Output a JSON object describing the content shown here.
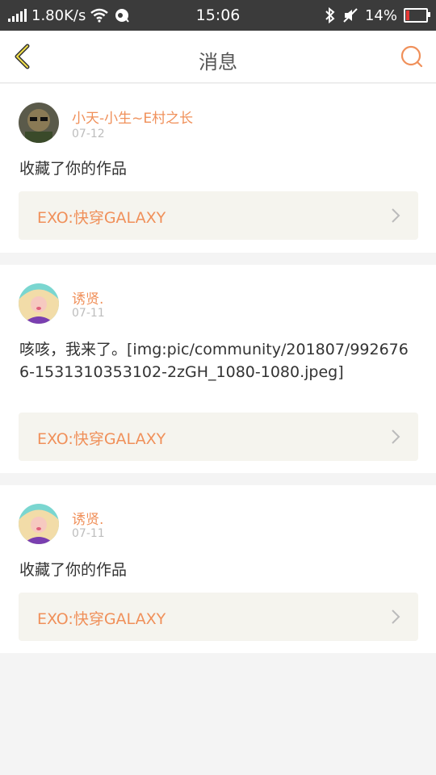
{
  "status_bar": {
    "speed": "1.80K/s",
    "time": "15:06",
    "battery": "14%"
  },
  "header": {
    "title": "消息"
  },
  "messages": [
    {
      "user": "小天-小生~E村之长",
      "date": "07-12",
      "content": "收藏了你的作品",
      "work_title": "EXO:快穿GALAXY"
    },
    {
      "user": "诱贤.",
      "date": "07-11",
      "content": "咳咳，我来了。[img:pic/community/201807/9926766-1531310353102-2zGH_1080-1080.jpeg]",
      "work_title": "EXO:快穿GALAXY"
    },
    {
      "user": "诱贤.",
      "date": "07-11",
      "content": "收藏了你的作品",
      "work_title": "EXO:快穿GALAXY"
    }
  ],
  "colors": {
    "accent": "#f0905a",
    "status_bar": "#3b3b3b",
    "link_bg": "#f5f4ee"
  },
  "icons": {
    "back": "chevron-left-icon",
    "search": "search-icon",
    "link_arrow": "chevron-right-icon"
  }
}
